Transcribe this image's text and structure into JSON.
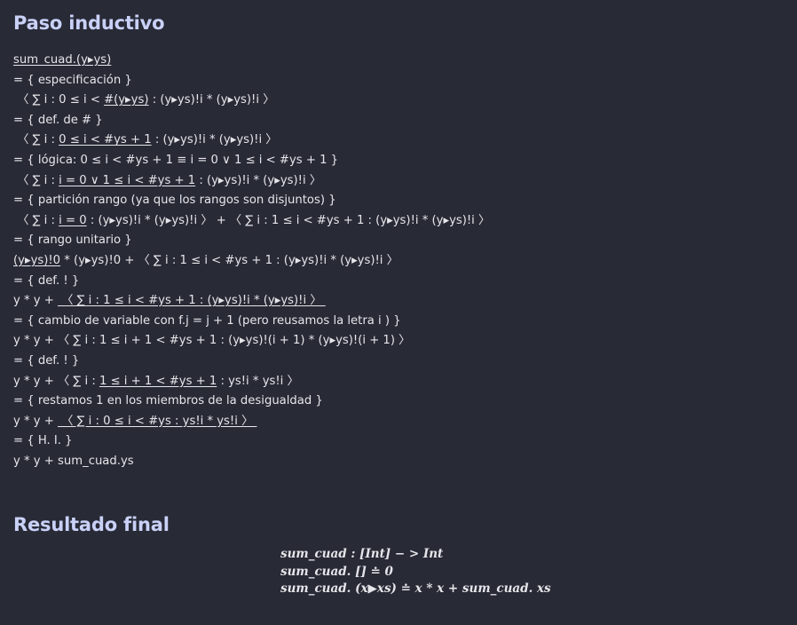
{
  "headings": {
    "inductive": "Paso inductivo",
    "final": "Resultado final"
  },
  "proof": [
    [
      {
        "t": "sum_cuad.(y▸ys)",
        "u": true
      }
    ],
    [
      {
        "t": "= { especificación }"
      }
    ],
    [
      {
        "t": " 〈 ∑ i : 0 ≤ i < "
      },
      {
        "t": "#(y▸ys)",
        "u": true
      },
      {
        "t": " : (y▸ys)!i * (y▸ys)!i 〉"
      }
    ],
    [
      {
        "t": "= { def. de # }"
      }
    ],
    [
      {
        "t": " 〈 ∑ i : "
      },
      {
        "t": "0 ≤ i < #ys + 1",
        "u": true
      },
      {
        "t": " : (y▸ys)!i * (y▸ys)!i 〉"
      }
    ],
    [
      {
        "t": "= { lógica: 0 ≤ i < #ys + 1 ≡ i = 0 ∨ 1 ≤ i < #ys + 1 }"
      }
    ],
    [
      {
        "t": " 〈 ∑ i : "
      },
      {
        "t": "i = 0 ∨ 1 ≤ i < #ys + 1",
        "u": true
      },
      {
        "t": " : (y▸ys)!i * (y▸ys)!i 〉"
      }
    ],
    [
      {
        "t": "= { partición rango (ya que los rangos son disjuntos) }"
      }
    ],
    [
      {
        "t": " 〈 ∑ i : "
      },
      {
        "t": "i = 0",
        "u": true
      },
      {
        "t": " : (y▸ys)!i * (y▸ys)!i 〉 + 〈 ∑ i : 1 ≤ i < #ys + 1 : (y▸ys)!i * (y▸ys)!i 〉"
      }
    ],
    [
      {
        "t": "= { rango unitario }"
      }
    ],
    [
      {
        "t": "(y▸ys)!0",
        "u": true
      },
      {
        "t": " * (y▸ys)!0 + 〈 ∑ i : 1 ≤ i < #ys + 1 : (y▸ys)!i * (y▸ys)!i 〉"
      }
    ],
    [
      {
        "t": "= { def. ! }"
      }
    ],
    [
      {
        "t": "y * y + "
      },
      {
        "t": " 〈 ∑ i : 1 ≤ i < #ys + 1 : (y▸ys)!i * (y▸ys)!i 〉 ",
        "u": true
      }
    ],
    [
      {
        "t": "= { cambio de variable con f.j = j + 1 (pero reusamos la letra i ) }"
      }
    ],
    [
      {
        "t": "y * y + 〈 ∑ i : 1 ≤ i + 1 < #ys + 1 : (y▸ys)!(i + 1) * (y▸ys)!(i + 1) 〉"
      }
    ],
    [
      {
        "t": "= { def. ! }"
      }
    ],
    [
      {
        "t": "y * y + 〈 ∑ i : "
      },
      {
        "t": "1 ≤ i + 1 < #ys + 1",
        "u": true
      },
      {
        "t": " : ys!i * ys!i 〉"
      }
    ],
    [
      {
        "t": "= { restamos 1 en los miembros de la desigualdad }"
      }
    ],
    [
      {
        "t": "y * y + "
      },
      {
        "t": " 〈 ∑ i : 0 ≤ i < #ys : ys!i * ys!i 〉 ",
        "u": true
      }
    ],
    [
      {
        "t": "= { H. I. }"
      }
    ],
    [
      {
        "t": "y * y + sum_cuad.ys"
      }
    ]
  ],
  "final": [
    "sum_cuad : [Int] − > Int",
    "sum_cuad. [] ≐ 0",
    "sum_cuad. (x▶xs) ≐ x * x + sum_cuad. xs"
  ]
}
